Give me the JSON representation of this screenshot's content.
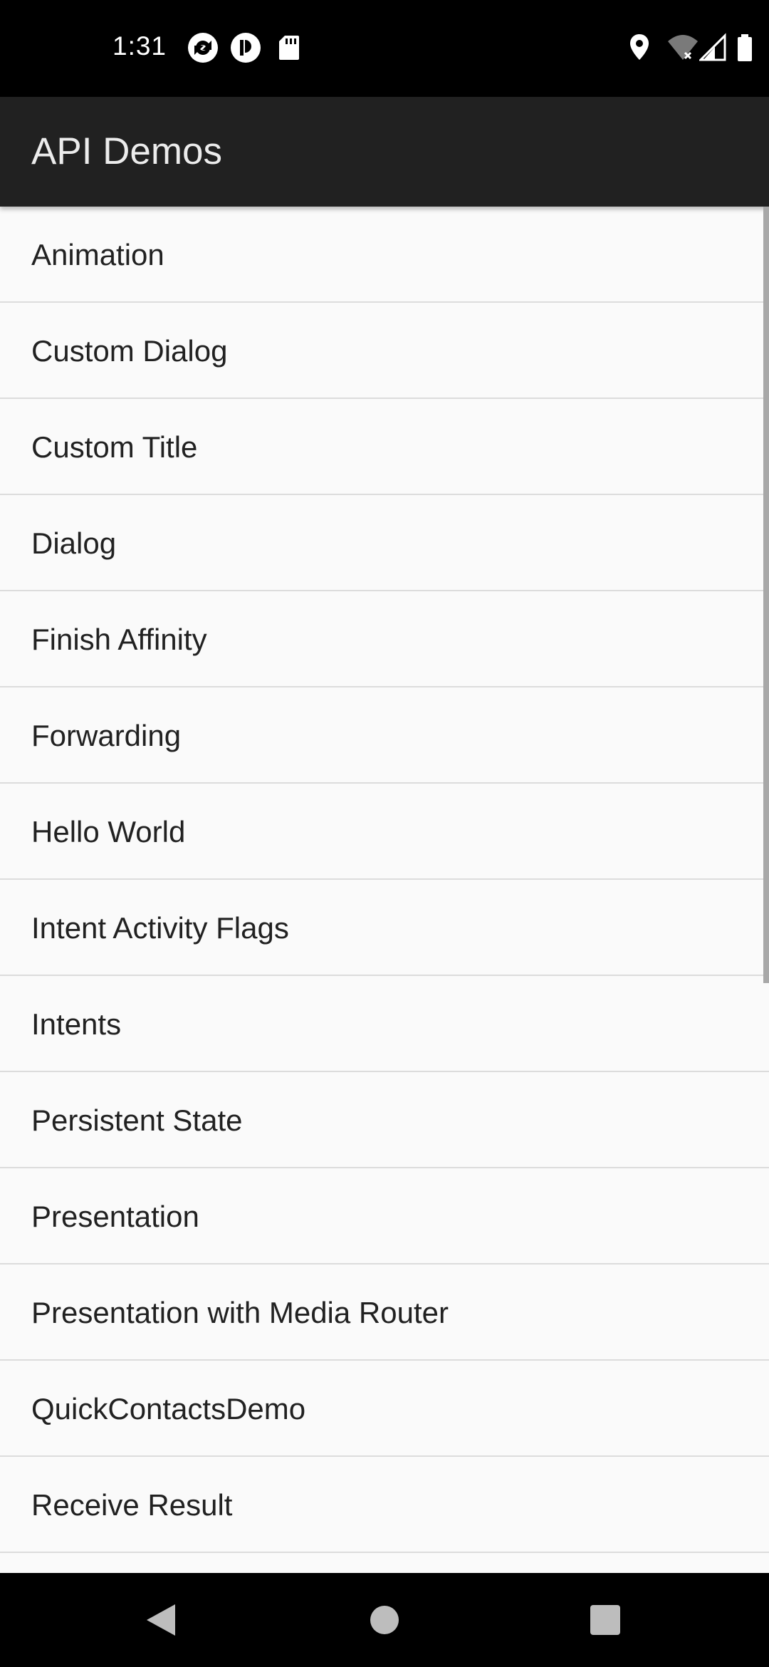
{
  "status_bar": {
    "time": "1:31",
    "icons": [
      "sync-icon",
      "app-notification-icon",
      "sd-card-icon",
      "location-icon",
      "wifi-off-icon",
      "cell-signal-icon",
      "battery-icon"
    ]
  },
  "app_bar": {
    "title": "API Demos"
  },
  "list": {
    "items": [
      {
        "label": "Animation"
      },
      {
        "label": "Custom Dialog"
      },
      {
        "label": "Custom Title"
      },
      {
        "label": "Dialog"
      },
      {
        "label": "Finish Affinity"
      },
      {
        "label": "Forwarding"
      },
      {
        "label": "Hello World"
      },
      {
        "label": "Intent Activity Flags"
      },
      {
        "label": "Intents"
      },
      {
        "label": "Persistent State"
      },
      {
        "label": "Presentation"
      },
      {
        "label": "Presentation with Media Router"
      },
      {
        "label": "QuickContactsDemo"
      },
      {
        "label": "Receive Result"
      },
      {
        "label": ""
      }
    ]
  },
  "nav_bar": {
    "buttons": [
      "back-icon",
      "home-icon",
      "recents-icon"
    ]
  },
  "colors": {
    "status_bar": "#000000",
    "app_bar": "#212121",
    "list_background": "#fafafa",
    "divider": "#dcdcdc",
    "text": "#212121"
  }
}
